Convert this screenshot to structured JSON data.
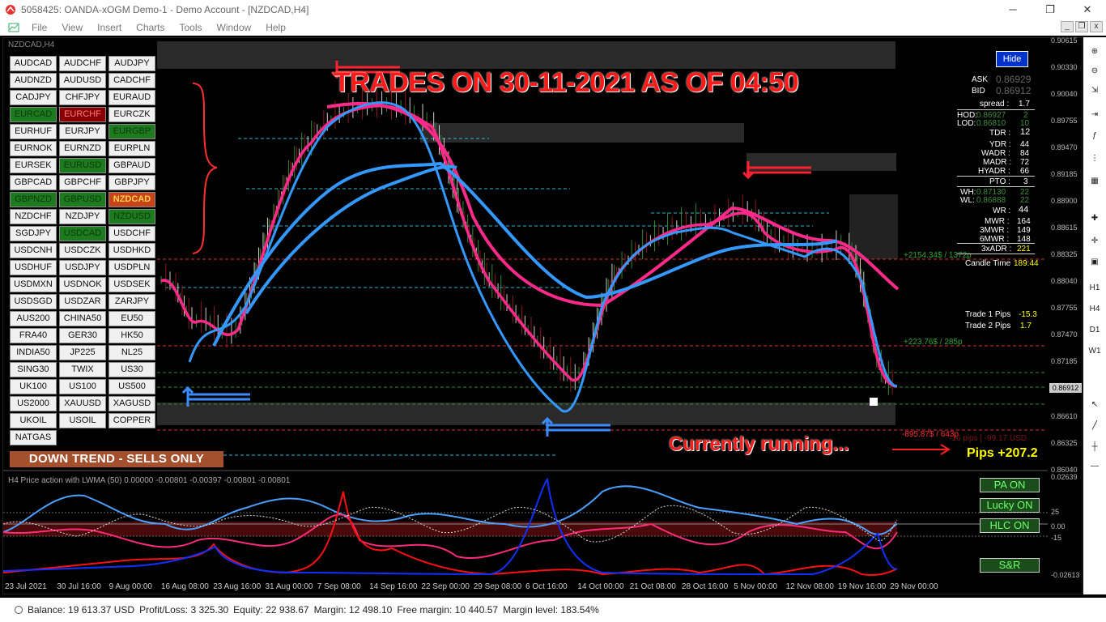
{
  "window": {
    "title": "5058425: OANDA-xOGM Demo-1 - Demo Account - [NZDCAD,H4]",
    "minimize": "─",
    "restore": "❐",
    "close": "✕"
  },
  "menu": [
    "File",
    "View",
    "Insert",
    "Charts",
    "Tools",
    "Window",
    "Help"
  ],
  "chart_title": "NZDCAD,H4",
  "symbols": [
    {
      "label": "AUDCAD",
      "style": ""
    },
    {
      "label": "AUDCHF",
      "style": ""
    },
    {
      "label": "AUDJPY",
      "style": ""
    },
    {
      "label": "AUDNZD",
      "style": ""
    },
    {
      "label": "AUDUSD",
      "style": ""
    },
    {
      "label": "CADCHF",
      "style": ""
    },
    {
      "label": "CADJPY",
      "style": ""
    },
    {
      "label": "CHFJPY",
      "style": ""
    },
    {
      "label": "EURAUD",
      "style": ""
    },
    {
      "label": "EURCAD",
      "style": "green"
    },
    {
      "label": "EURCHF",
      "style": "red"
    },
    {
      "label": "EURCZK",
      "style": ""
    },
    {
      "label": "EURHUF",
      "style": ""
    },
    {
      "label": "EURJPY",
      "style": ""
    },
    {
      "label": "EURGBP",
      "style": "green"
    },
    {
      "label": "EURNOK",
      "style": ""
    },
    {
      "label": "EURNZD",
      "style": ""
    },
    {
      "label": "EURPLN",
      "style": ""
    },
    {
      "label": "EURSEK",
      "style": ""
    },
    {
      "label": "EURUSD",
      "style": "green"
    },
    {
      "label": "GBPAUD",
      "style": ""
    },
    {
      "label": "GBPCAD",
      "style": ""
    },
    {
      "label": "GBPCHF",
      "style": ""
    },
    {
      "label": "GBPJPY",
      "style": ""
    },
    {
      "label": "GBPNZD",
      "style": "green"
    },
    {
      "label": "GBPUSD",
      "style": "green"
    },
    {
      "label": "NZDCAD",
      "style": "orange"
    },
    {
      "label": "NZDCHF",
      "style": ""
    },
    {
      "label": "NZDJPY",
      "style": ""
    },
    {
      "label": "NZDUSD",
      "style": "green"
    },
    {
      "label": "SGDJPY",
      "style": ""
    },
    {
      "label": "USDCAD",
      "style": "green"
    },
    {
      "label": "USDCHF",
      "style": ""
    },
    {
      "label": "USDCNH",
      "style": ""
    },
    {
      "label": "USDCZK",
      "style": ""
    },
    {
      "label": "USDHKD",
      "style": ""
    },
    {
      "label": "USDHUF",
      "style": ""
    },
    {
      "label": "USDJPY",
      "style": ""
    },
    {
      "label": "USDPLN",
      "style": ""
    },
    {
      "label": "USDMXN",
      "style": ""
    },
    {
      "label": "USDNOK",
      "style": ""
    },
    {
      "label": "USDSEK",
      "style": ""
    },
    {
      "label": "USDSGD",
      "style": ""
    },
    {
      "label": "USDZAR",
      "style": ""
    },
    {
      "label": "ZARJPY",
      "style": ""
    },
    {
      "label": "AUS200",
      "style": ""
    },
    {
      "label": "CHINA50",
      "style": ""
    },
    {
      "label": "EU50",
      "style": ""
    },
    {
      "label": "FRA40",
      "style": ""
    },
    {
      "label": "GER30",
      "style": ""
    },
    {
      "label": "HK50",
      "style": ""
    },
    {
      "label": "INDIA50",
      "style": ""
    },
    {
      "label": "JP225",
      "style": ""
    },
    {
      "label": "NL25",
      "style": ""
    },
    {
      "label": "SING30",
      "style": ""
    },
    {
      "label": "TWIX",
      "style": ""
    },
    {
      "label": "US30",
      "style": ""
    },
    {
      "label": "UK100",
      "style": ""
    },
    {
      "label": "US100",
      "style": ""
    },
    {
      "label": "US500",
      "style": ""
    },
    {
      "label": "US2000",
      "style": ""
    },
    {
      "label": "XAUUSD",
      "style": ""
    },
    {
      "label": "XAGUSD",
      "style": ""
    },
    {
      "label": "UKOIL",
      "style": ""
    },
    {
      "label": "USOIL",
      "style": ""
    },
    {
      "label": "COPPER",
      "style": ""
    },
    {
      "label": "NATGAS",
      "style": ""
    }
  ],
  "trend_banner": "DOWN TREND - SELLS ONLY",
  "headline": "TRADES ON 30-11-2021 AS OF 04:50",
  "running_note": "Currently running...",
  "pips_total": "Pips +207.2",
  "hide_label": "Hide",
  "info": {
    "ask_label": "ASK",
    "ask_value": "0.86929",
    "bid_label": "BID",
    "bid_value": "0.86912",
    "spread_label": "spread :",
    "spread_value": "1.7",
    "hod_label": "HOD:",
    "hod_value": "0.86927",
    "hod_n": "2",
    "lod_label": "LOD:",
    "lod_value": "0.86810",
    "lod_n": "10",
    "tdr_label": "TDR :",
    "tdr_value": "12",
    "ydr_label": "YDR :",
    "ydr_value": "44",
    "wadr_label": "WADR :",
    "wadr_value": "84",
    "madr_label": "MADR :",
    "madr_value": "72",
    "hyadr_label": "HYADR :",
    "hyadr_value": "66",
    "pto_label": "PTO :",
    "pto_value": "3",
    "wh_label": "WH:",
    "wh_value": "0.87130",
    "wh_n": "22",
    "wl_label": "WL:",
    "wl_value": "0.86888",
    "wl_n": "22",
    "wr_label": "WR :",
    "wr_value": "44",
    "mwr_label": "MWR :",
    "mwr_value": "164",
    "mwr3_label": "3MWR :",
    "mwr3_value": "149",
    "mwr6_label": "6MWR :",
    "mwr6_value": "148",
    "xadr3_label": "3xADR :",
    "xadr3_value": "221",
    "candle_label": "Candle Time",
    "candle_value": "189:44",
    "trade1_label": "Trade 1 Pips",
    "trade1_value": "-15.3",
    "trade2_label": "Trade 2 Pips",
    "trade2_value": "1.7"
  },
  "chart_annotations": {
    "level_top": "+2154.34$ / 1372p",
    "level_mid": "+223.76$ / 285p",
    "level_low": "-895.87$ / 643p",
    "level_low_pips": "-16 pips | -99.17 USD"
  },
  "indicator_label": "H4 Price action with LWMA (50) 0.00000 -0.00801 -0.00397 -0.00801 -0.00801",
  "indicator_buttons": [
    "PA ON",
    "Lucky ON",
    "HLC ON",
    "S&R"
  ],
  "price_axis": [
    "0.90615",
    "0.90330",
    "0.90040",
    "0.89755",
    "0.89470",
    "0.89185",
    "0.88900",
    "0.88615",
    "0.88325",
    "0.88040",
    "0.87755",
    "0.87470",
    "0.87185",
    "0.86912",
    "0.86610",
    "0.86325",
    "0.86040"
  ],
  "current_price": "0.86912",
  "ind_axis": [
    "0.02639",
    "25",
    "0.00",
    "-15",
    "-0.02613"
  ],
  "time_axis": [
    "23 Jul 2021",
    "30 Jul 16:00",
    "9 Aug 00:00",
    "16 Aug 08:00",
    "23 Aug 16:00",
    "31 Aug 00:00",
    "7 Sep 08:00",
    "14 Sep 16:00",
    "22 Sep 00:00",
    "29 Sep 08:00",
    "6 Oct 16:00",
    "14 Oct 00:00",
    "21 Oct 08:00",
    "28 Oct 16:00",
    "5 Nov 00:00",
    "12 Nov 08:00",
    "19 Nov 16:00",
    "29 Nov 00:00"
  ],
  "right_toolbar": [
    "H1",
    "H4",
    "D1",
    "W1"
  ],
  "status": {
    "balance": "Balance: 19 613.37 USD",
    "profit": "Profit/Loss: 3 325.30",
    "equity": "Equity: 22 938.67",
    "margin": "Margin: 12 498.10",
    "free_margin": "Free margin: 10 440.57",
    "margin_level": "Margin level: 183.54%"
  },
  "colors": {
    "ema_pink": "#ff2a8a",
    "ema_blue": "#3399ff",
    "headline_red": "#ff1a1a",
    "green_btn": "#1e7a1e",
    "orange_btn": "#c8421a"
  }
}
